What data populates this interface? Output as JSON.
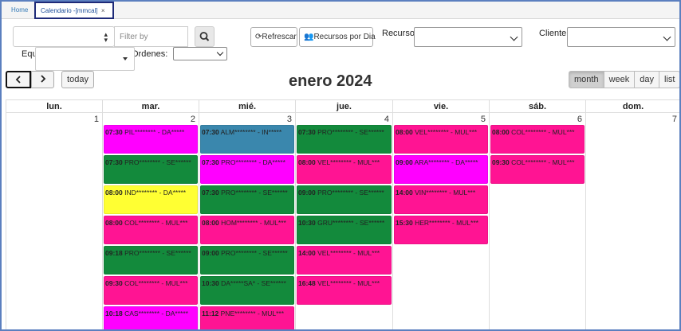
{
  "tabs": [
    {
      "label": "Home"
    },
    {
      "label": "Calendario -[mmcal]",
      "close": "×"
    }
  ],
  "toolbar": {
    "filter_placeholder": "Filter by",
    "refresh_label": "Refrescar",
    "resources_label": "Recursos por Dia",
    "resource_label": "Recurso:",
    "client_label": "Cliente:",
    "team_label": "Equipo:",
    "orders_label": "Ordenes:"
  },
  "calendar": {
    "title": "enero 2024",
    "prev_icon": "chevron-left-icon",
    "next_icon": "chevron-right-icon",
    "today_label": "today",
    "views": [
      "month",
      "week",
      "day",
      "list"
    ],
    "active_view": "month",
    "weekdays": [
      "lun.",
      "mar.",
      "mié.",
      "jue.",
      "vie.",
      "sáb.",
      "dom."
    ],
    "days": [
      "1",
      "2",
      "3",
      "4",
      "5",
      "6",
      "7"
    ]
  },
  "colors": {
    "magenta": "#ff00ff",
    "pink": "#ff1493",
    "green": "#138a3c",
    "blue": "#3a87ad",
    "yellow": "#ffff33"
  },
  "events": {
    "tue": [
      {
        "time": "07:30",
        "text": "PIL******** - DA*****",
        "color": "magenta"
      },
      {
        "time": "07:30",
        "text": "PRO******** - SE******",
        "color": "green"
      },
      {
        "time": "08:00",
        "text": "IND******** - DA*****",
        "color": "yellow"
      },
      {
        "time": "08:00",
        "text": "COL******** - MUL***",
        "color": "pink"
      },
      {
        "time": "09:18",
        "text": "PRO******** - SE******",
        "color": "green"
      },
      {
        "time": "09:30",
        "text": "COL******** - MUL***",
        "color": "pink"
      },
      {
        "time": "10:18",
        "text": "CAS******** - DA*****",
        "color": "magenta"
      }
    ],
    "wed": [
      {
        "time": "07:30",
        "text": "ALM******** - IN*****",
        "color": "blue"
      },
      {
        "time": "07:30",
        "text": "PRO******** - DA*****",
        "color": "magenta"
      },
      {
        "time": "07:30",
        "text": "PRO******** - SE******",
        "color": "green"
      },
      {
        "time": "08:00",
        "text": "HOM******** - MUL***",
        "color": "pink"
      },
      {
        "time": "09:00",
        "text": "PRO******** - SE******",
        "color": "green"
      },
      {
        "time": "10:30",
        "text": "DA*****SA* - SE******",
        "color": "green"
      },
      {
        "time": "11:12",
        "text": "PNE******** - MUL***",
        "color": "pink"
      }
    ],
    "thu": [
      {
        "time": "07:30",
        "text": "PRO******** - SE******",
        "color": "green"
      },
      {
        "time": "08:00",
        "text": "VEL******** - MUL***",
        "color": "pink"
      },
      {
        "time": "09:00",
        "text": "PRO******** - SE******",
        "color": "green"
      },
      {
        "time": "10:30",
        "text": "GRU******** - SE******",
        "color": "green"
      },
      {
        "time": "14:00",
        "text": "VEL******** - MUL***",
        "color": "pink"
      },
      {
        "time": "16:48",
        "text": "VEL******** - MUL***",
        "color": "pink"
      }
    ],
    "fri": [
      {
        "time": "08:00",
        "text": "VEL******** - MUL***",
        "color": "pink"
      },
      {
        "time": "09:00",
        "text": "ARA******** - DA*****",
        "color": "magenta"
      },
      {
        "time": "14:00",
        "text": "VIN******** - MUL***",
        "color": "pink"
      },
      {
        "time": "15:30",
        "text": "HER******** - MUL***",
        "color": "pink"
      }
    ],
    "sat": [
      {
        "time": "08:00",
        "text": "COL******** - MUL***",
        "color": "pink"
      },
      {
        "time": "09:30",
        "text": "COL******** - MUL***",
        "color": "pink"
      }
    ]
  }
}
